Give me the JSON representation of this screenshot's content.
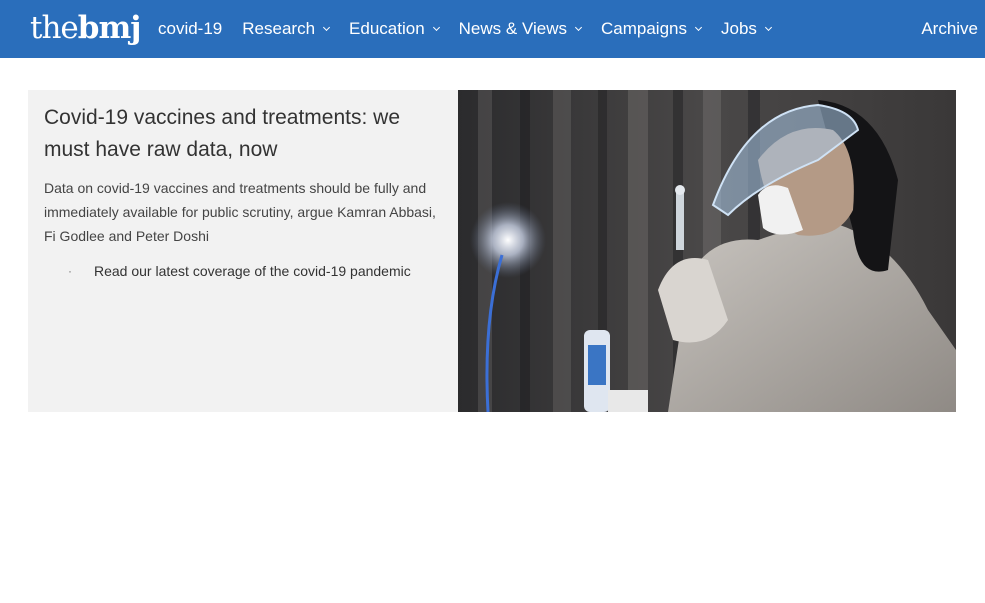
{
  "header": {
    "logo": {
      "the": "the",
      "bmj": "bmj"
    },
    "nav": [
      {
        "label": "covid-19",
        "has_menu": false
      },
      {
        "label": "Research",
        "has_menu": true
      },
      {
        "label": "Education",
        "has_menu": true
      },
      {
        "label": "News & Views",
        "has_menu": true
      },
      {
        "label": "Campaigns",
        "has_menu": true
      },
      {
        "label": "Jobs",
        "has_menu": true
      }
    ],
    "archive": "Archive",
    "colors": {
      "nav_background": "#2a6ebb",
      "nav_text": "#ffffff"
    }
  },
  "feature": {
    "headline": "Covid-19 vaccines and treatments: we must have raw data, now",
    "standfirst": "Data on covid-19 vaccines and treatments should be fully and immediately available for public scrutiny, argue Kamran Abbasi, Fi Godlee and Peter Doshi",
    "bullets": [
      {
        "marker": "·",
        "text": "Read our latest coverage of the covid-19 pandemic"
      }
    ],
    "colors": {
      "panel_background": "#f2f2f2"
    }
  }
}
